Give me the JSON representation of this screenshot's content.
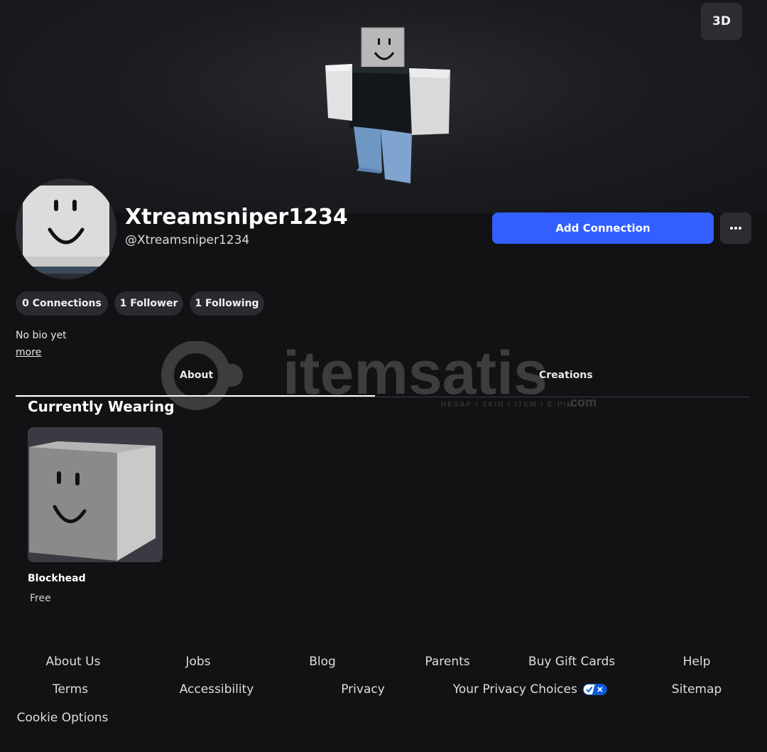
{
  "hero": {
    "view_toggle_label": "3D"
  },
  "profile": {
    "display_name": "Xtreamsniper1234",
    "username": "@Xtreamsniper1234",
    "add_connection_label": "Add Connection",
    "more_options_glyph": "•••",
    "stats": {
      "connections": "0 Connections",
      "followers": "1 Follower",
      "following": "1 Following"
    },
    "bio": "No bio yet",
    "more_link": "more"
  },
  "tabs": [
    {
      "label": "About",
      "active": true
    },
    {
      "label": "Creations",
      "active": false
    }
  ],
  "watermark": {
    "brand": "itemsatis",
    "tagline": "HESAP / SKIN / ITEM / E-PIN",
    "suffix": ".com"
  },
  "currently_wearing": {
    "title": "Currently Wearing",
    "items": [
      {
        "name": "Blockhead",
        "price": "Free",
        "icon": "blockhead-icon"
      }
    ]
  },
  "footer": {
    "links": [
      "About Us",
      "Jobs",
      "Blog",
      "Parents",
      "Buy Gift Cards",
      "Help",
      "Terms",
      "Accessibility",
      "Privacy",
      "Your Privacy Choices",
      "Sitemap",
      "Cookie Options"
    ]
  },
  "colors": {
    "accent": "#335fff",
    "background": "#121215",
    "surface": "#2a2b30"
  }
}
